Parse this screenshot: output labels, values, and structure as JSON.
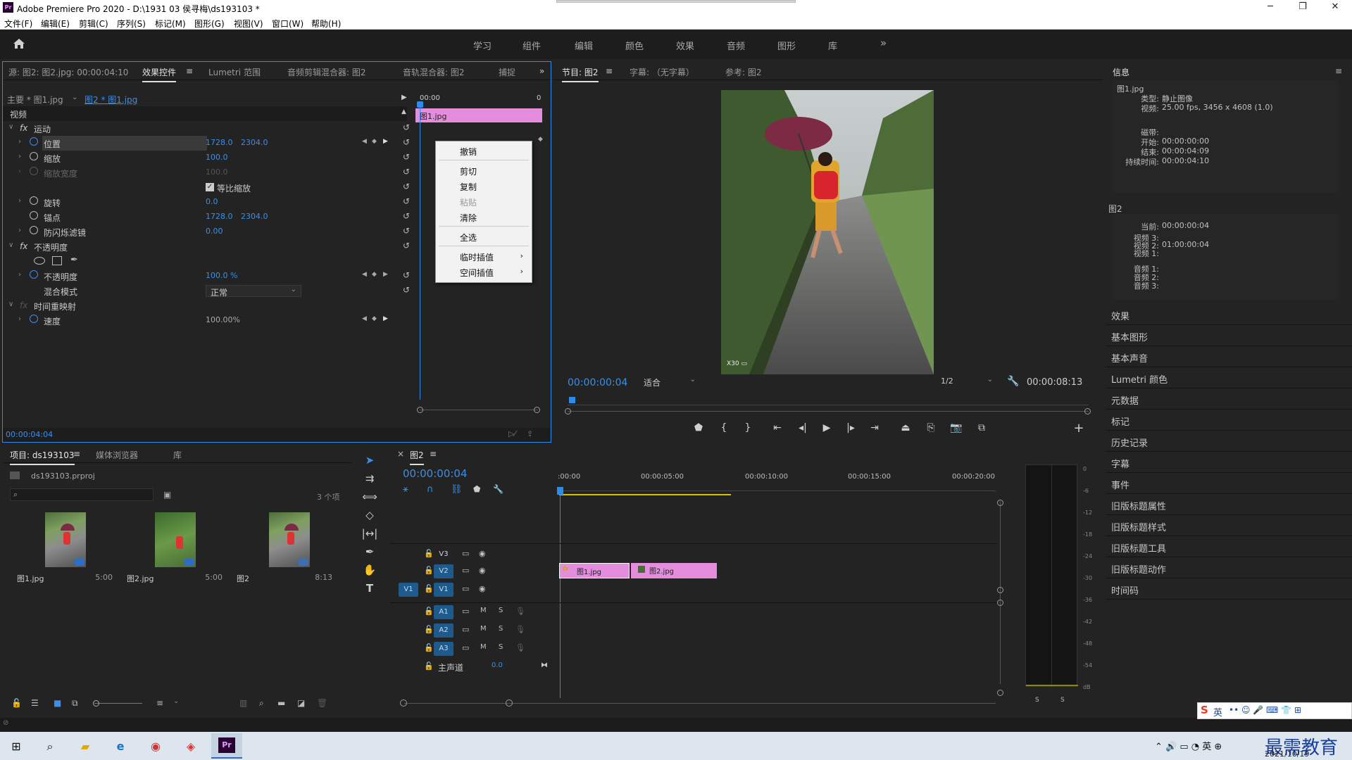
{
  "window": {
    "title": "Adobe Premiere Pro 2020 - D:\\1931 03 侯寻梅\\ds193103 *",
    "app_icon": "Pr",
    "minimize": "─",
    "maximize": "❐",
    "close": "✕"
  },
  "menu": [
    "文件(F)",
    "编辑(E)",
    "剪辑(C)",
    "序列(S)",
    "标记(M)",
    "图形(G)",
    "视图(V)",
    "窗口(W)",
    "帮助(H)"
  ],
  "workspaces": [
    "学习",
    "组件",
    "编辑",
    "颜色",
    "效果",
    "音频",
    "图形",
    "库"
  ],
  "workspace_more": "»",
  "source_panel": {
    "tabs": [
      "源: 图2: 图2.jpg: 00:00:04:10",
      "效果控件",
      "Lumetri 范围",
      "音频剪辑混合器: 图2",
      "音轨混合器: 图2",
      "捕捉"
    ],
    "tab_menu": "≡",
    "more": "»",
    "master_label": "主要 * 图1.jpg",
    "clip_label": "图2 * 图1.jpg",
    "section_video": "视频",
    "fx_label": "fx",
    "motion": "运动",
    "position": {
      "label": "位置",
      "x": "1728.0",
      "y": "2304.0"
    },
    "scale": {
      "label": "缩放",
      "v": "100.0"
    },
    "scale_width": {
      "label": "缩放宽度",
      "v": "100.0"
    },
    "uniform_scale": "等比缩放",
    "rotation": {
      "label": "旋转",
      "v": "0.0"
    },
    "anchor": {
      "label": "锚点",
      "x": "1728.0",
      "y": "2304.0"
    },
    "anti_flicker": {
      "label": "防闪烁滤镜",
      "v": "0.00"
    },
    "opacity_section": "不透明度",
    "opacity": {
      "label": "不透明度",
      "v": "100.0 %"
    },
    "blend_mode": {
      "label": "混合模式",
      "v": "正常"
    },
    "time_remap": "时间重映射",
    "speed": {
      "label": "速度",
      "v": "100.00%"
    },
    "timecode": "00:00:04:04",
    "mini_time": "00:00",
    "mini_end": "0",
    "mini_clip": "图1.jpg"
  },
  "context_menu": {
    "items": [
      "撤销",
      "剪切",
      "复制",
      "粘贴",
      "清除",
      "全选",
      "临时插值",
      "空间插值"
    ],
    "disabled": [
      "粘贴"
    ],
    "submenu_arrow": "›"
  },
  "program": {
    "tabs": [
      "节目: 图2",
      "字幕: （无字幕）",
      "参考: 图2"
    ],
    "tab_menu": "≡",
    "timecode_left": "00:00:00:04",
    "fit": "适合",
    "res": "1/2",
    "timecode_right": "00:00:08:13",
    "watermark": "X30 ▭",
    "buttons": [
      "marker-icon",
      "mark-in-icon",
      "mark-out-icon",
      "go-to-in-icon",
      "step-back-icon",
      "play-icon",
      "step-forward-icon",
      "go-to-out-icon",
      "lift-icon",
      "extract-icon",
      "export-frame-icon",
      "comparison-view-icon"
    ],
    "add": "+"
  },
  "info": {
    "title": "信息",
    "menu": "≡",
    "clip": "图1.jpg",
    "type_k": "类型:",
    "type_v": "静止图像",
    "video_k": "视频:",
    "video_v": "25.00 fps, 3456 x 4608 (1.0)",
    "tape_k": "磁带:",
    "start_k": "开始:",
    "start_v": "00:00:00:00",
    "end_k": "结束:",
    "end_v": "00:00:04:09",
    "dur_k": "持续时间:",
    "dur_v": "00:00:04:10",
    "seq": "图2",
    "cur_k": "当前:",
    "cur_v": "00:00:00:04",
    "v3_k": "视频 3:",
    "v2_k": "视频 2:",
    "v2_v": "01:00:00:04",
    "v1_k": "视频 1:",
    "a1_k": "音频 1:",
    "a2_k": "音频 2:",
    "a3_k": "音频 3:"
  },
  "side_panels": [
    "效果",
    "基本图形",
    "基本声音",
    "Lumetri 颜色",
    "元数据",
    "标记",
    "历史记录",
    "字幕",
    "事件",
    "旧版标题属性",
    "旧版标题样式",
    "旧版标题工具",
    "旧版标题动作",
    "时间码"
  ],
  "project": {
    "tabs": [
      "项目: ds193103",
      "媒体浏览器",
      "库"
    ],
    "tab_menu": "≡",
    "file": "ds193103.prproj",
    "count": "3 个项",
    "items": [
      {
        "name": "图1.jpg",
        "dur": "5:00"
      },
      {
        "name": "图2.jpg",
        "dur": "5:00"
      },
      {
        "name": "图2",
        "dur": "8:13"
      }
    ]
  },
  "timeline": {
    "tab": "图2",
    "close": "×",
    "tab_menu": "≡",
    "timecode": "00:00:00:04",
    "ruler": [
      ":00:00",
      "00:00:05:00",
      "00:00:10:00",
      "00:00:15:00",
      "00:00:20:00"
    ],
    "tracks_video": [
      "V3",
      "V2",
      "V1"
    ],
    "source_patch": "V1",
    "tracks_audio": [
      "A1",
      "A2",
      "A3"
    ],
    "mute": "M",
    "solo": "S",
    "master": "主声道",
    "master_val": "0.0",
    "clip1": "图1.jpg",
    "clip2": "图2.jpg",
    "fx": "fx"
  },
  "meter": {
    "scale": [
      "0",
      "-6",
      "-12",
      "-18",
      "-24",
      "-30",
      "-36",
      "-42",
      "-48",
      "-54",
      "dB"
    ],
    "solo_l": "S",
    "solo_r": "S"
  },
  "taskbar": {
    "time": "2021/10/19",
    "ime": "英",
    "brand": "最需教育"
  },
  "colors": {
    "accent": "#2d8ceb",
    "clip_pink": "#e38ddc",
    "timecode_blue": "#3b8fe6",
    "playhead": "#2d8ceb",
    "work_area": "#d4c400"
  }
}
